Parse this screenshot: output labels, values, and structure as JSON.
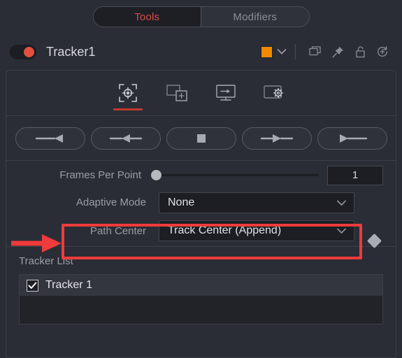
{
  "top_tabs": {
    "items": [
      {
        "label": "Tools",
        "active": true
      },
      {
        "label": "Modifiers",
        "active": false
      }
    ],
    "active_color": "#d94f46"
  },
  "tool_header": {
    "enabled_toggle": "tool-enabled-toggle",
    "title": "Tracker1",
    "color_swatch": "#f08a00",
    "icons": [
      {
        "name": "color-chevron-down-icon",
        "glyph": "chevron-down"
      },
      {
        "name": "duplicate-icon",
        "glyph": "copy"
      },
      {
        "name": "pin-icon",
        "glyph": "pin"
      },
      {
        "name": "lock-icon",
        "glyph": "padlock-open"
      },
      {
        "name": "reset-version-icon",
        "glyph": "history-plus"
      }
    ]
  },
  "icon_tabs": {
    "items": [
      {
        "name": "tracker-tab",
        "active": true
      },
      {
        "name": "corner-pin-tab",
        "active": false
      },
      {
        "name": "stabilize-tab",
        "active": false
      },
      {
        "name": "operation-tab",
        "active": false
      }
    ],
    "indicator_color": "#c0392f"
  },
  "transport": {
    "buttons": [
      {
        "name": "track-reverse-to-start-button",
        "glyph": "line-left-triangle"
      },
      {
        "name": "track-reverse-one-frame-button",
        "glyph": "line-left-triangle-line"
      },
      {
        "name": "stop-tracking-button",
        "glyph": "square"
      },
      {
        "name": "track-forward-one-frame-button",
        "glyph": "line-right-triangle-line"
      },
      {
        "name": "track-forward-to-end-button",
        "glyph": "right-triangle-line"
      }
    ]
  },
  "controls": {
    "frames_per_point": {
      "label": "Frames Per Point",
      "value": "1",
      "slider_position_percent": 0
    },
    "adaptive_mode": {
      "label": "Adaptive Mode",
      "value": "None"
    },
    "path_center": {
      "label": "Path Center",
      "value": "Track Center (Append)",
      "highlighted": true,
      "highlight_color": "#ef3b3b"
    },
    "keyframe_marker": "keyframe-diamond"
  },
  "tracker_list": {
    "title": "Tracker List",
    "rows": [
      {
        "label": "Tracker 1",
        "checked": true,
        "selected": true
      }
    ]
  }
}
